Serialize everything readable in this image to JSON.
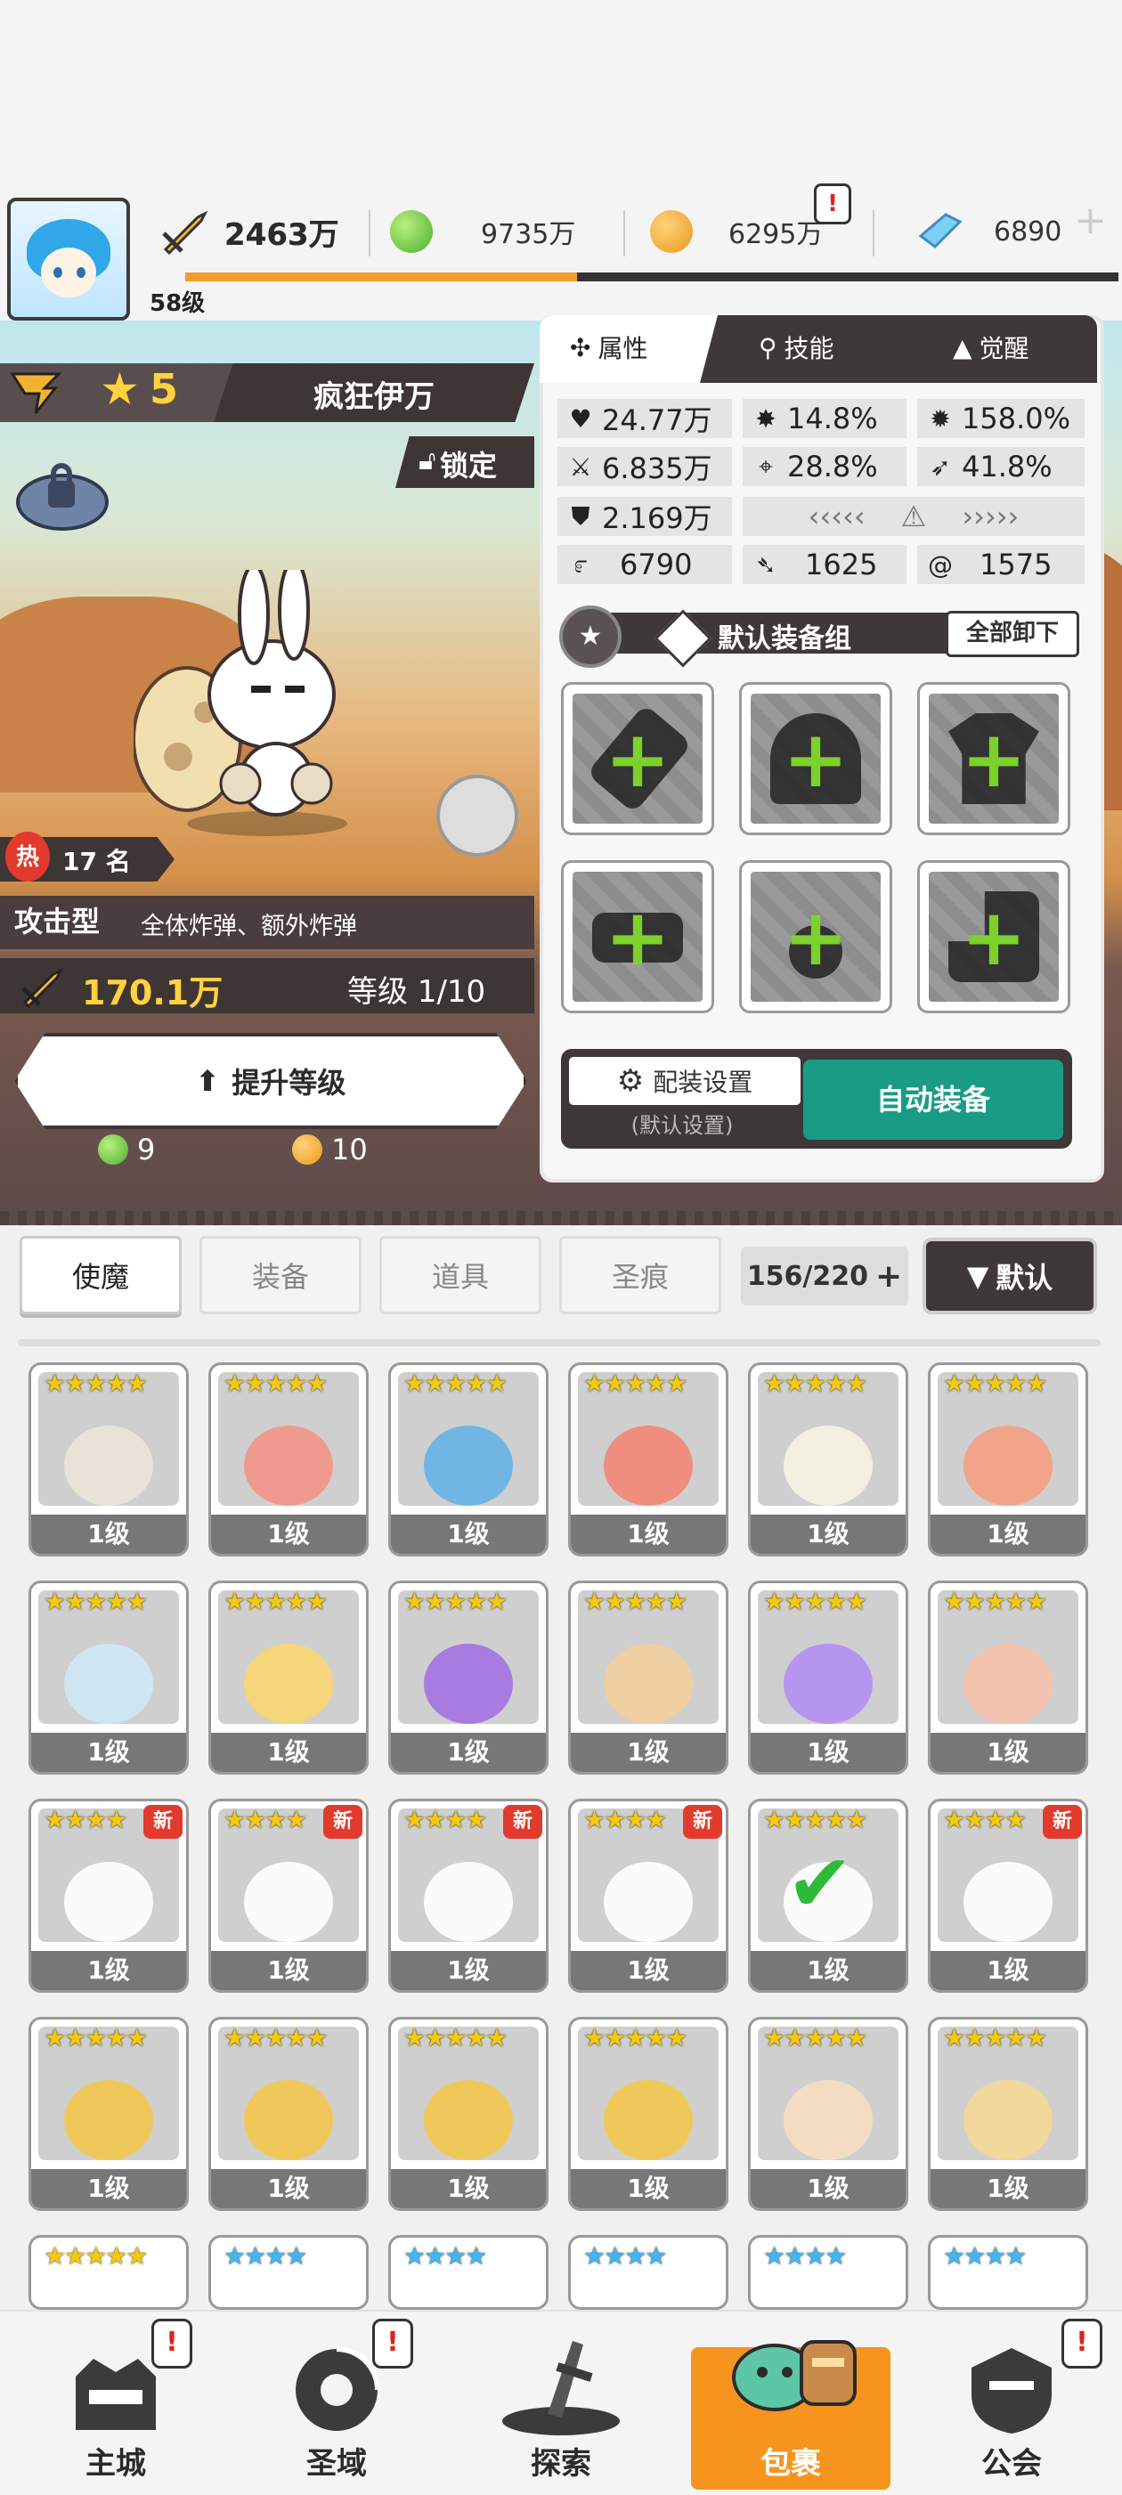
{
  "player": {
    "level": "58级",
    "xp_fraction": 0.42
  },
  "resources": {
    "power": "2463万",
    "green": "9735万",
    "gold": "6295万",
    "gem": "6890"
  },
  "hero": {
    "stars": "5",
    "name": "疯狂伊万",
    "lock": "锁定",
    "rank": "17 名",
    "hot": "热",
    "type": "攻击型",
    "type_desc": "全体炸弹、额外炸弹",
    "power": "170.1万",
    "level": "等级 1/10",
    "upgrade_label": "提升等级",
    "cost_green": "9",
    "cost_gold": "10"
  },
  "panel": {
    "tabs": [
      {
        "label": "属性",
        "icon": "attribute-icon"
      },
      {
        "label": "技能",
        "icon": "skill-icon"
      },
      {
        "label": "觉醒",
        "icon": "awaken-icon"
      }
    ],
    "stats": {
      "hp": "24.77万",
      "crit": "14.8%",
      "crit_dmg": "158.0%",
      "atk": "6.835万",
      "accuracy": "28.8%",
      "speed": "41.8%",
      "defense": "2.169万",
      "stat_a": "6790",
      "stat_b": "1625",
      "stat_c": "1575"
    },
    "equip_set": "默认装备组",
    "unequip_all": "全部卸下",
    "slots": [
      "weapon-slot",
      "helmet-slot",
      "armor-slot",
      "belt-slot",
      "necklace-slot",
      "boots-slot"
    ],
    "config_label": "配装设置",
    "config_sub": "(默认设置)",
    "auto_equip": "自动装备"
  },
  "inventory": {
    "tabs": [
      "使魔",
      "装备",
      "道具",
      "圣痕"
    ],
    "active_tab": 0,
    "capacity": "156/220",
    "sort_label": "默认",
    "cards": [
      {
        "level": "1级",
        "stars": "★★★★★",
        "color": "#e8e2d8",
        "new": false
      },
      {
        "level": "1级",
        "stars": "★★★★★",
        "color": "#f09a8f",
        "new": false
      },
      {
        "level": "1级",
        "stars": "★★★★★",
        "color": "#6fb6e4",
        "new": false
      },
      {
        "level": "1级",
        "stars": "★★★★★",
        "color": "#ef8e7f",
        "new": false
      },
      {
        "level": "1级",
        "stars": "★★★★★",
        "color": "#f4efe3",
        "new": false
      },
      {
        "level": "1级",
        "stars": "★★★★★",
        "color": "#f2a48b",
        "new": false
      },
      {
        "level": "1级",
        "stars": "★★★★★",
        "color": "#cfe6f2",
        "new": false
      },
      {
        "level": "1级",
        "stars": "★★★★★",
        "color": "#f5d67b",
        "new": false
      },
      {
        "level": "1级",
        "stars": "★★★★★",
        "color": "#a77be0",
        "new": false
      },
      {
        "level": "1级",
        "stars": "★★★★★",
        "color": "#f0cfa2",
        "new": false
      },
      {
        "level": "1级",
        "stars": "★★★★★",
        "color": "#b695ef",
        "new": false
      },
      {
        "level": "1级",
        "stars": "★★★★★",
        "color": "#f2c4b0",
        "new": false
      },
      {
        "level": "1级",
        "stars": "★★★★",
        "color": "#fbfbfb",
        "new": true
      },
      {
        "level": "1级",
        "stars": "★★★★",
        "color": "#fbfbfb",
        "new": true
      },
      {
        "level": "1级",
        "stars": "★★★★",
        "color": "#fbfbfb",
        "new": true
      },
      {
        "level": "1级",
        "stars": "★★★★",
        "color": "#fbfbfb",
        "new": true
      },
      {
        "level": "1级",
        "stars": "★★★★★",
        "color": "#fbfbfb",
        "new": false,
        "selected": true
      },
      {
        "level": "1级",
        "stars": "★★★★",
        "color": "#fbfbfb",
        "new": true
      },
      {
        "level": "1级",
        "stars": "★★★★★",
        "color": "#f0c85a",
        "new": false
      },
      {
        "level": "1级",
        "stars": "★★★★★",
        "color": "#f0c85a",
        "new": false
      },
      {
        "level": "1级",
        "stars": "★★★★★",
        "color": "#f0c85a",
        "new": false
      },
      {
        "level": "1级",
        "stars": "★★★★★",
        "color": "#f0c85a",
        "new": false
      },
      {
        "level": "1级",
        "stars": "★★★★★",
        "color": "#f4dcc2",
        "new": false
      },
      {
        "level": "1级",
        "stars": "★★★★★",
        "color": "#f2d79a",
        "new": false
      }
    ],
    "partial_row_stars": [
      "★★★★★",
      "★★★★",
      "★★★★",
      "★★★★",
      "★★★★",
      "★★★★"
    ],
    "new_tag": "新"
  },
  "nav": {
    "items": [
      {
        "label": "主城",
        "alert": true
      },
      {
        "label": "圣域",
        "alert": true
      },
      {
        "label": "探索",
        "alert": false
      },
      {
        "label": "包裹",
        "alert": false,
        "active": true
      },
      {
        "label": "公会",
        "alert": true
      }
    ]
  },
  "colors": {
    "accent_orange": "#f7941d",
    "auto_equip_teal": "#1a9b86",
    "dark_panel": "#3f3838",
    "star_gold": "#f4c90e"
  }
}
